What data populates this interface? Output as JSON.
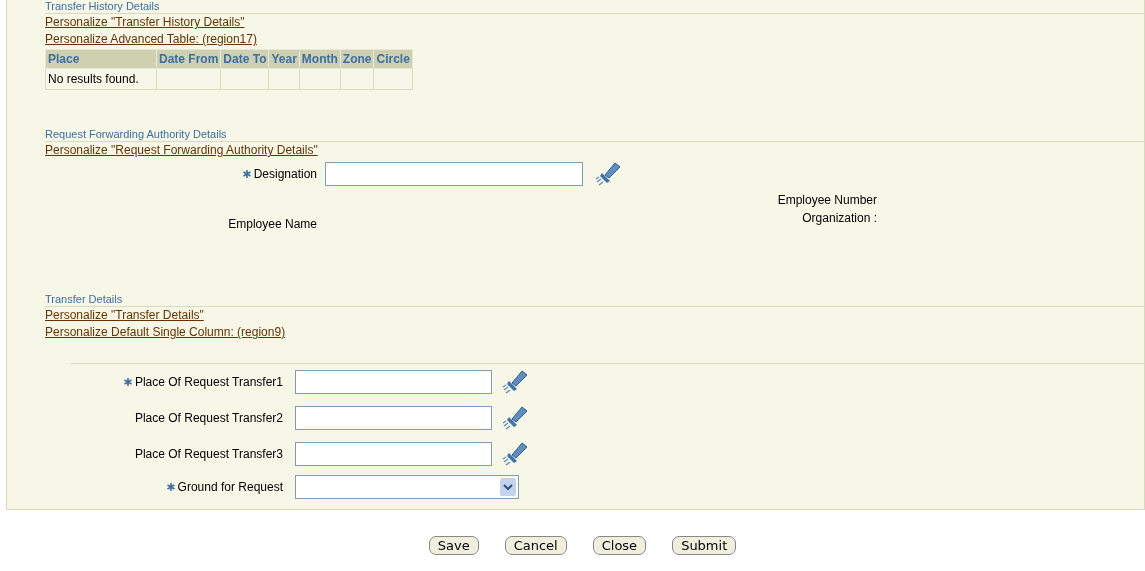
{
  "history": {
    "heading": "Transfer History Details",
    "links": [
      "Personalize \"Transfer History Details\"",
      "Personalize Advanced Table: (region17)"
    ],
    "table": {
      "columns": [
        "Place",
        "Date From",
        "Date To",
        "Year",
        "Month",
        "Zone",
        "Circle"
      ],
      "empty_message": "No results found."
    }
  },
  "forwarding": {
    "heading": "Request Forwarding Authority Details",
    "links": [
      "Personalize \"Request Forwarding Authority Details\""
    ],
    "designation": {
      "label": "Designation",
      "required": true
    },
    "employee_name": "Employee Name",
    "employee_number": "Employee Number",
    "organization": "Organization :"
  },
  "transfer": {
    "heading": "Transfer Details",
    "links": [
      "Personalize \"Transfer Details\"",
      "Personalize Default Single Column: (region9)"
    ],
    "fields": [
      {
        "label": "Place Of Request Transfer1",
        "required": true,
        "kind": "lov"
      },
      {
        "label": "Place Of Request Transfer2",
        "required": false,
        "kind": "lov"
      },
      {
        "label": "Place Of Request Transfer3",
        "required": false,
        "kind": "lov"
      },
      {
        "label": "Ground for Request",
        "required": true,
        "kind": "select"
      }
    ]
  },
  "buttons": [
    "Save",
    "Cancel",
    "Close",
    "Submit"
  ]
}
